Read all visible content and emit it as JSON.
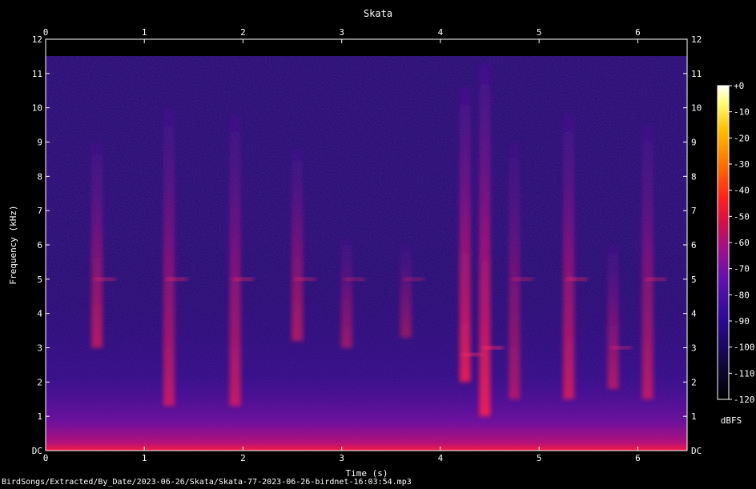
{
  "chart_data": {
    "type": "heatmap",
    "title": "Skata",
    "xlabel": "Time (s)",
    "ylabel": "Frequency (kHz)",
    "xlim": [
      0,
      6.5
    ],
    "ylim": [
      0,
      12
    ],
    "x_ticks": [
      "0",
      "1",
      "2",
      "3",
      "4",
      "5",
      "6"
    ],
    "y_ticks": [
      "DC",
      "1",
      "2",
      "3",
      "4",
      "5",
      "6",
      "7",
      "8",
      "9",
      "10",
      "11",
      "12"
    ],
    "colorbar": {
      "label": "dBFS",
      "range": [
        -120,
        0
      ],
      "ticks": [
        "+0",
        "-10",
        "-20",
        "-30",
        "-40",
        "-50",
        "-60",
        "-70",
        "-80",
        "-90",
        "-100",
        "-110",
        "-120"
      ],
      "colormap": [
        "#000000",
        "#1a0a5a",
        "#3a0aa0",
        "#7a10b0",
        "#b0107a",
        "#e01040",
        "#ff3010",
        "#ff8000",
        "#ffd000",
        "#ffffe0"
      ]
    },
    "background_level_dbfs": -95,
    "upper_cutoff_khz": 11.5,
    "call_events": [
      {
        "t": 0.52,
        "f_low": 3.0,
        "f_high": 9.0,
        "peak_khz": 5.0,
        "level_dbfs": -60
      },
      {
        "t": 1.25,
        "f_low": 1.3,
        "f_high": 10.0,
        "peak_khz": 5.0,
        "level_dbfs": -58
      },
      {
        "t": 1.92,
        "f_low": 1.3,
        "f_high": 9.8,
        "peak_khz": 5.0,
        "level_dbfs": -58
      },
      {
        "t": 2.55,
        "f_low": 3.2,
        "f_high": 8.8,
        "peak_khz": 5.0,
        "level_dbfs": -62
      },
      {
        "t": 3.05,
        "f_low": 3.0,
        "f_high": 6.2,
        "peak_khz": 5.0,
        "level_dbfs": -66
      },
      {
        "t": 3.65,
        "f_low": 3.3,
        "f_high": 6.0,
        "peak_khz": 5.0,
        "level_dbfs": -68
      },
      {
        "t": 4.25,
        "f_low": 2.0,
        "f_high": 10.6,
        "peak_khz": 2.8,
        "level_dbfs": -50
      },
      {
        "t": 4.45,
        "f_low": 1.0,
        "f_high": 11.3,
        "peak_khz": 3.0,
        "level_dbfs": -48
      },
      {
        "t": 4.75,
        "f_low": 1.5,
        "f_high": 9.0,
        "peak_khz": 5.0,
        "level_dbfs": -64
      },
      {
        "t": 5.3,
        "f_low": 1.5,
        "f_high": 9.8,
        "peak_khz": 5.0,
        "level_dbfs": -56
      },
      {
        "t": 5.75,
        "f_low": 1.8,
        "f_high": 6.0,
        "peak_khz": 3.0,
        "level_dbfs": -62
      },
      {
        "t": 6.1,
        "f_low": 1.5,
        "f_high": 9.5,
        "peak_khz": 5.0,
        "level_dbfs": -60
      }
    ]
  },
  "source_path": "BirdSongs/Extracted/By_Date/2023-06-26/Skata/Skata-77-2023-06-26-birdnet-16:03:54.mp3"
}
